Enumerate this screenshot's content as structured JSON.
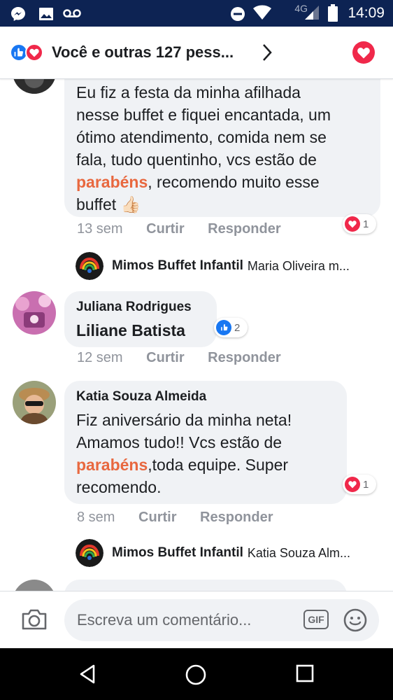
{
  "status_bar": {
    "time": "14:09",
    "network": "4G",
    "icons": [
      "messenger-icon",
      "image-icon",
      "voicemail-icon",
      "dnd-icon",
      "wifi-icon",
      "signal-icon",
      "battery-icon"
    ]
  },
  "header": {
    "title": "Você e outras 127 pess...",
    "icons": [
      "like-reaction-icon",
      "love-reaction-icon",
      "chevron-right-icon",
      "love-button-icon"
    ]
  },
  "comments": [
    {
      "text_lines": [
        "Eu fiz a festa da minha  afilhada",
        "nesse buffet e fiquei encantada, um",
        "ótimo atendimento, comida nem se",
        "fala, tudo quentinho, vcs estão de"
      ],
      "highlight": "parabéns",
      "after_highlight": ", recomendo muito esse",
      "last_line": "buffet 👍🏻",
      "time": "13 sem",
      "like_label": "Curtir",
      "reply_label": "Responder",
      "reaction_count": "1",
      "reply_preview": {
        "author": "Mimos Buffet Infantil",
        "text": "Maria Oliveira m..."
      }
    },
    {
      "author": "Juliana Rodrigues",
      "text": "Liliane Batista",
      "time": "12 sem",
      "like_label": "Curtir",
      "reply_label": "Responder",
      "reaction_count": "2"
    },
    {
      "author": "Katia Souza Almeida",
      "text_lines": [
        "Fiz aniversário da minha neta!",
        "Amamos tudo!! Vcs estão de"
      ],
      "highlight": "parabéns",
      "after_highlight": ",toda equipe. Super",
      "last_line": "recomendo.",
      "time": "8 sem",
      "like_label": "Curtir",
      "reply_label": "Responder",
      "reaction_count": "1",
      "reply_preview": {
        "author": "Mimos Buffet Infantil",
        "text": "Katia Souza Alm..."
      }
    }
  ],
  "composer": {
    "placeholder": "Escreva um comentário...",
    "gif_label": "GIF"
  },
  "colors": {
    "status_bar_bg": "#0d2353",
    "like_blue": "#1877f2",
    "love_red": "#f0284a",
    "highlight_orange": "#e8683f",
    "bubble_gray": "#f0f2f5",
    "meta_gray": "#90949c"
  }
}
